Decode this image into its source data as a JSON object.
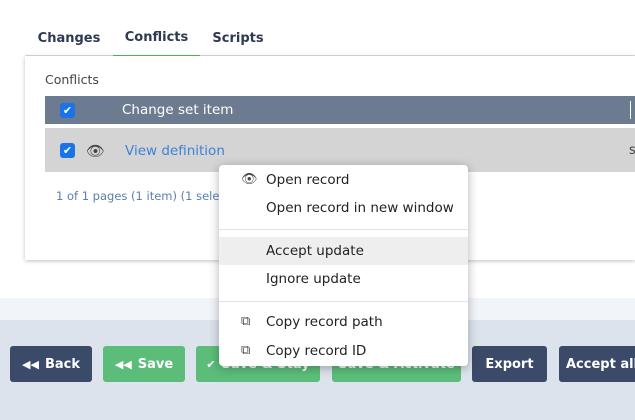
{
  "tabs": [
    {
      "label": "Changes"
    },
    {
      "label": "Conflicts",
      "active": true
    },
    {
      "label": "Scripts"
    }
  ],
  "panel": {
    "title": "Conflicts",
    "table": {
      "header": "Change set item",
      "rows": [
        {
          "link": "View definition",
          "truncated_cell": "s"
        }
      ]
    },
    "pager": "1 of 1 pages (1 item)  (1 selected)"
  },
  "context_menu": {
    "items": [
      {
        "icon": "eye-icon",
        "label": "Open record"
      },
      {
        "icon": "",
        "label": "Open record in new window"
      },
      {
        "icon": "",
        "label": "Accept update"
      },
      {
        "icon": "",
        "label": "Ignore update"
      },
      {
        "icon": "copy-icon",
        "label": "Copy record path"
      },
      {
        "icon": "copy-icon",
        "label": "Copy record ID"
      }
    ]
  },
  "footer": {
    "buttons": [
      {
        "label": "Back",
        "icon": "double-left-icon",
        "style": "dark"
      },
      {
        "label": "Save",
        "icon": "double-left-icon",
        "style": "green"
      },
      {
        "label": "Save & Stay",
        "icon": "check-icon",
        "style": "green"
      },
      {
        "label": "Save & Activate",
        "icon": "",
        "style": "green"
      },
      {
        "label": "Export",
        "icon": "",
        "style": "dark"
      },
      {
        "label": "Accept all",
        "icon": "",
        "style": "dark"
      }
    ]
  },
  "colors": {
    "accent_green": "#5cbd7a",
    "dark_button": "#3a4a68",
    "table_header": "#6d7b90",
    "link": "#3b82d6",
    "checkbox": "#1a73e8"
  }
}
